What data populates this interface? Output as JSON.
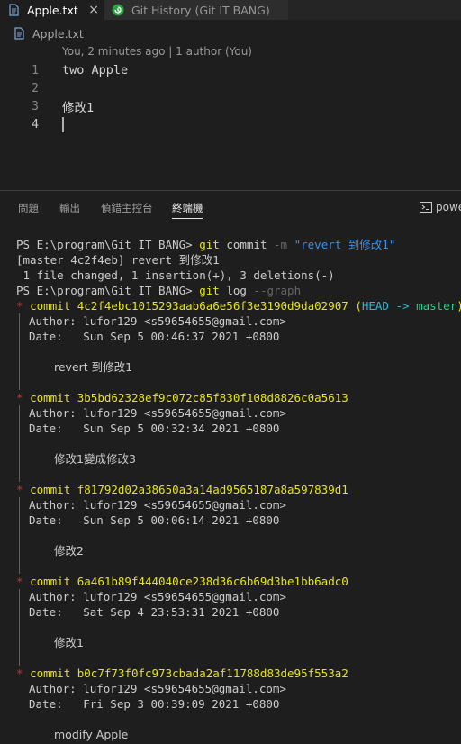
{
  "tabs": [
    {
      "label": "Apple.txt",
      "close": "×"
    },
    {
      "label": "Git History (Git IT BANG)"
    }
  ],
  "breadcrumb": {
    "file": "Apple.txt"
  },
  "editor": {
    "codelens": "You, 2 minutes ago | 1 author (You)",
    "lines": [
      {
        "num": "1",
        "text": "two Apple"
      },
      {
        "num": "2",
        "text": ""
      },
      {
        "num": "3",
        "text": "修改1"
      },
      {
        "num": "4",
        "text": ""
      }
    ]
  },
  "panel": {
    "tabs": [
      "問題",
      "輸出",
      "偵錯主控台",
      "終端機"
    ],
    "terminal_selector": "powe"
  },
  "terminal": {
    "prompt1": "PS E:\\program\\Git IT BANG>",
    "cmd1_git": "git",
    "cmd1_sub": "commit",
    "cmd1_flag": "-m",
    "cmd1_msg": "\"revert 到修改1\"",
    "out1": "[master 4c2f4eb] revert 到修改1",
    "out2": " 1 file changed, 1 insertion(+), 3 deletions(-)",
    "prompt2": "PS E:\\program\\Git IT BANG>",
    "cmd2_git": "git",
    "cmd2_sub": "log",
    "cmd2_flag": "--graph",
    "commits": [
      {
        "hash": "commit 4c2f4ebc1015293aab6a6e56f3e3190d9da02907",
        "head": "HEAD ->",
        "branch": "master",
        "author": "Author: lufor129 <s59654655@gmail.com>",
        "date": "Date:   Sun Sep 5 00:46:37 2021 +0800",
        "message": "revert 到修改1"
      },
      {
        "hash": "commit 3b5bd62328ef9c072c85f830f108d8826c0a5613",
        "author": "Author: lufor129 <s59654655@gmail.com>",
        "date": "Date:   Sun Sep 5 00:32:34 2021 +0800",
        "message": "修改1變成修改3"
      },
      {
        "hash": "commit f81792d02a38650a3a14ad9565187a8a597839d1",
        "author": "Author: lufor129 <s59654655@gmail.com>",
        "date": "Date:   Sun Sep 5 00:06:14 2021 +0800",
        "message": "修改2"
      },
      {
        "hash": "commit 6a461b89f444040ce238d36c6b69d3be1bb6adc0",
        "author": "Author: lufor129 <s59654655@gmail.com>",
        "date": "Date:   Sat Sep 4 23:53:31 2021 +0800",
        "message": "修改1"
      },
      {
        "hash": "commit b0c7f73f0fc973cbada2af11788d83de95f553a2",
        "author": "Author: lufor129 <s59654655@gmail.com>",
        "date": "Date:   Fri Sep 3 00:39:09 2021 +0800",
        "message": "modify Apple"
      }
    ]
  },
  "colors": {
    "editor_bg": "#1e1e1e",
    "tab_bar_bg": "#252526",
    "git_yellow": "#e5e510",
    "graph_red": "#cd3131",
    "head_cyan": "#29b8db",
    "branch_green": "#23d18b",
    "string_blue": "#3b8eea"
  },
  "icons": [
    "file-text-icon",
    "git-history-icon",
    "close-icon",
    "terminal-icon"
  ]
}
